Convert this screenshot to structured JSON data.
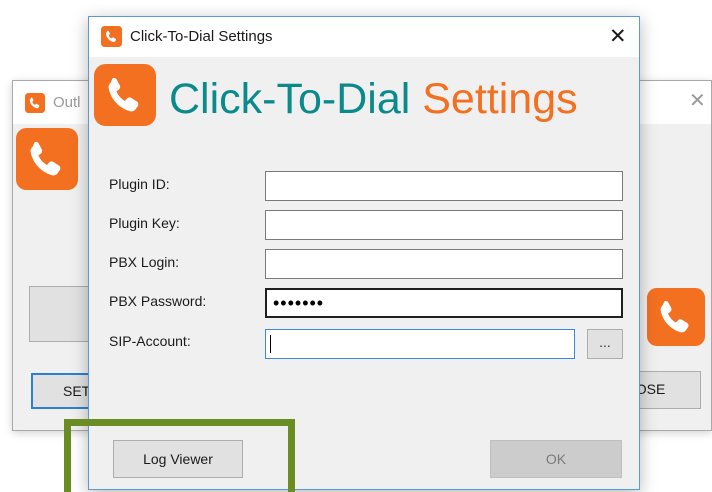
{
  "background_window": {
    "title": "Outl",
    "settings_button_label": "SETT",
    "close_button_label": "LOSE"
  },
  "dialog": {
    "title": "Click-To-Dial Settings",
    "header": {
      "part1": "Click-To-Dial",
      "part2": "Settings"
    },
    "fields": {
      "plugin_id": {
        "label": "Plugin ID:",
        "value": ""
      },
      "plugin_key": {
        "label": "Plugin Key:",
        "value": ""
      },
      "pbx_login": {
        "label": "PBX Login:",
        "value": ""
      },
      "pbx_password": {
        "label": "PBX Password:",
        "value": "•••••••"
      },
      "sip_account": {
        "label": "SIP-Account:",
        "value": ""
      }
    },
    "browse_label": "...",
    "log_viewer_label": "Log Viewer",
    "ok_label": "OK"
  },
  "colors": {
    "brand_orange": "#f37021",
    "brand_teal": "#0b8a8c",
    "highlight_green": "#6a8c23",
    "focus_blue": "#3c8ad8"
  },
  "icons": {
    "app_icon": "phone-handset-icon",
    "close_icon": "close-icon"
  }
}
